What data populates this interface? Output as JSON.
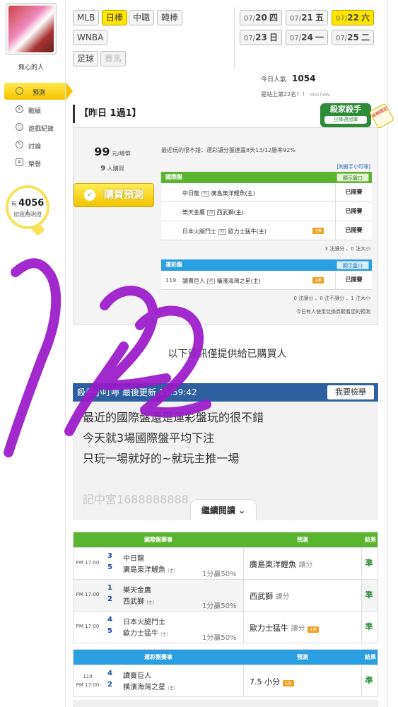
{
  "user": {
    "name": "無心的人"
  },
  "nav": [
    {
      "label": "預測",
      "icon": "target-icon",
      "active": true
    },
    {
      "label": "戰績",
      "icon": "chart-icon"
    },
    {
      "label": "遊戲紀錄",
      "icon": "record-icon"
    },
    {
      "label": "討論",
      "icon": "chat-icon"
    },
    {
      "label": "榮譽",
      "icon": "medal-icon"
    }
  ],
  "likes": {
    "prefix": "有",
    "count": "4056",
    "suffix": "人",
    "text": "加我為明燈"
  },
  "sports": [
    "MLB",
    "日棒",
    "中職",
    "韓棒",
    "WNBA",
    "足球",
    "賽馬"
  ],
  "dates": [
    {
      "md": "07/",
      "d": "20",
      "wd": "四"
    },
    {
      "md": "07/",
      "d": "21",
      "wd": "五"
    },
    {
      "md": "07/",
      "d": "22",
      "wd": "六"
    },
    {
      "md": "07/",
      "d": "23",
      "wd": "日"
    },
    {
      "md": "07/",
      "d": "24",
      "wd": "一"
    },
    {
      "md": "07/",
      "d": "25",
      "wd": "二"
    }
  ],
  "popularity": {
    "label": "今日人氣",
    "value": "1054",
    "rank": "是站上第22名！！",
    "rank_small": "(RSSTWA)"
  },
  "badge": {
    "title": "殺家殺手",
    "sub": "日棒週冠軍",
    "ribbon": "長期穩定"
  },
  "yesterday": {
    "title": "【昨日 1過1】"
  },
  "price": {
    "value": "99",
    "unit": "元/場幣"
  },
  "buyers": {
    "value": "9",
    "unit": "人購買"
  },
  "buy_button": "購買預測",
  "note": "最近玩的很不錯：運彩讓分盤連贏8天13/12勝率92%",
  "helper_link": "[附殺手小叮嚀]",
  "intl": {
    "header": "國際盤",
    "show_odds": "顯示盤口",
    "games": [
      {
        "away": "中日龍",
        "home": "廣島東洋鯉魚(主)",
        "tag": "",
        "status": "已開賽"
      },
      {
        "away": "樂天金鷹",
        "home": "西武獅(主)",
        "tag": "",
        "status": "已開賽"
      },
      {
        "away": "日本火腿鬥士",
        "home": "歐力士猛牛(主)",
        "tag": "主推",
        "status": "已開賽"
      }
    ],
    "stats": "3 注讓分 、0 注大小"
  },
  "lottery": {
    "header": "運彩盤",
    "show_odds": "顯示盤口",
    "games": [
      {
        "num": "119",
        "away": "讀賣巨人",
        "home": "橫濱海灣之星(主)",
        "tag": "主推",
        "status": "已開賽"
      }
    ],
    "stats": "0 注讓分 、0 注不讓分 、1 注大小",
    "exchange": "今日有人使用兌換券觀看您的預測"
  },
  "locked_text": "以下資訊僅提供給已購買人",
  "killer": {
    "title": "殺手小叮嚀",
    "updated": "最後更新",
    "time": "11:59:42",
    "report": "我要檢舉",
    "lines": [
      "最近的國際盤還是運彩盤玩的很不錯",
      "今天就3場國際盤平均下注",
      "只玩一場就好的~就玩主推一場",
      "",
      "記中宮1688888888"
    ]
  },
  "continue_label": "繼續閱讀",
  "results_intl": {
    "headers": [
      "國際盤賽事",
      "預測",
      "結果"
    ],
    "rows": [
      {
        "time": "PM 17:00",
        "n1": "3",
        "t1": "中日龍",
        "n2": "5",
        "t2": "廣島東洋鯉魚",
        "host": "(主)",
        "odds": "1分贏50%",
        "pick": "廣島東洋鯉魚",
        "unit": "讓分",
        "tag": "",
        "result": "準"
      },
      {
        "time": "PM 17:00",
        "n1": "1",
        "t1": "樂天金鷹",
        "n2": "2",
        "t2": "西武獅",
        "host": "(主)",
        "odds": "1分贏50%",
        "pick": "西武獅",
        "unit": "讓分",
        "tag": "",
        "result": "準"
      },
      {
        "time": "PM 17:00",
        "n1": "4",
        "t1": "日本火腿鬥士",
        "n2": "5",
        "t2": "歐力士猛牛",
        "host": "(主)",
        "odds": "1分贏50%",
        "pick": "歐力士猛牛",
        "unit": "讓分",
        "tag": "主推",
        "result": "準"
      }
    ]
  },
  "results_lottery": {
    "headers": [
      "運彩盤賽事",
      "預測",
      "結果"
    ],
    "rows": [
      {
        "num": "119",
        "time": "PM 17:00",
        "n1": "4",
        "t1": "讀賣巨人",
        "n2": "2",
        "t2": "橫濱海灣之星",
        "host": "(主)",
        "pick": "7.5 小分",
        "tag": "主推",
        "result": "準"
      }
    ]
  },
  "overlay_text": "7/22",
  "colors": {
    "yellow": "#ffe600",
    "green": "#5ab52e",
    "blue": "#2a9ee0",
    "navy": "#2e5fa0",
    "scribble": "#9b19c9"
  }
}
